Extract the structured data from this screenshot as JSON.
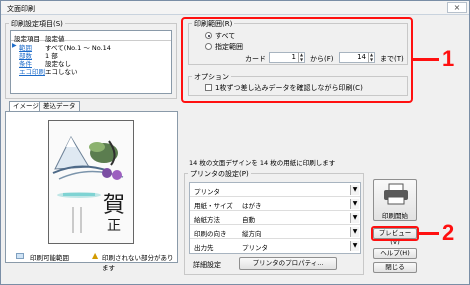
{
  "window": {
    "title": "文面印刷",
    "close": "×"
  },
  "left_group": {
    "title": "印刷設定項目(S)",
    "col1": "設定項目",
    "col2": "設定値",
    "rows": [
      {
        "item": "範囲",
        "value": "すべて(No.1 ～ No.14"
      },
      {
        "item": "部数",
        "value": "1 部"
      },
      {
        "item": "条件",
        "value": "設定なし"
      },
      {
        "item": "エコ印刷",
        "value": "エコしない"
      }
    ]
  },
  "range_group": {
    "title": "印刷範囲(R)",
    "all_label": "すべて",
    "range_label": "指定範囲",
    "card_label": "カード",
    "from_value": "1",
    "from_label": "から(F)",
    "to_value": "14",
    "to_label": "まで(T)"
  },
  "option_group": {
    "title": "オプション",
    "check_label": "1枚ずつ差し込みデータを確認しながら印刷(C)"
  },
  "tabs": {
    "image": "イメージ",
    "merge": "差込データ"
  },
  "preview": {
    "card_text_big": "賀",
    "card_text_big2": "正",
    "print_area_label": "印刷可能範囲",
    "warning_label": "印刷されない部分があります"
  },
  "info_text": "14 枚の文面デザインを 14 枚の用紙に印刷します",
  "printer_group": {
    "title": "プリンタの設定(P)",
    "rows": [
      {
        "label": "プリンタ",
        "value": ""
      },
      {
        "label": "用紙・サイズ",
        "value": "はがき"
      },
      {
        "label": "給紙方法",
        "value": "自動"
      },
      {
        "label": "印刷の向き",
        "value": "縦方向"
      },
      {
        "label": "出力先",
        "value": "プリンタ"
      }
    ],
    "detail_label": "詳細設定",
    "properties_button": "プリンタのプロパティ..."
  },
  "buttons": {
    "print_start": "印刷開始",
    "preview": "プレビュー(V)",
    "help": "ヘルプ(H)",
    "close": "閉じる"
  },
  "callouts": {
    "one": "1",
    "two": "2"
  },
  "colors": {
    "callout": "#ff1010",
    "panel_border": "#8a9aa9"
  }
}
